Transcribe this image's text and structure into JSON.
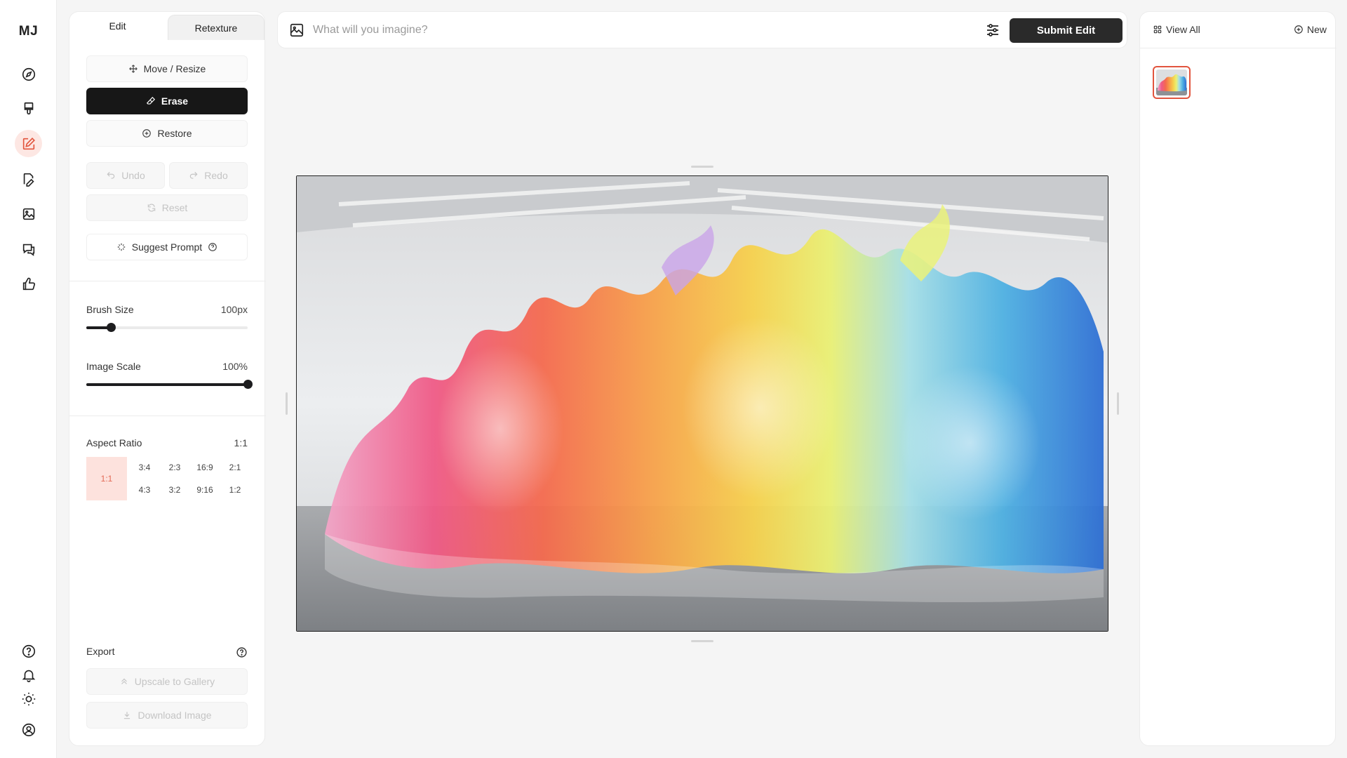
{
  "app": {
    "logo": "MJ"
  },
  "rail": {
    "items": [
      {
        "name": "explore-icon"
      },
      {
        "name": "brush-icon"
      },
      {
        "name": "edit-icon",
        "active": true
      },
      {
        "name": "organize-icon"
      },
      {
        "name": "gallery-icon"
      },
      {
        "name": "chat-icon"
      },
      {
        "name": "like-icon"
      }
    ],
    "bottom": [
      {
        "name": "help-icon"
      },
      {
        "name": "bell-icon"
      },
      {
        "name": "sun-icon"
      },
      {
        "name": "account-icon"
      }
    ]
  },
  "panel": {
    "tabs": {
      "edit": "Edit",
      "retexture": "Retexture"
    },
    "tools": {
      "move_resize": "Move / Resize",
      "erase": "Erase",
      "restore": "Restore"
    },
    "history": {
      "undo": "Undo",
      "redo": "Redo",
      "reset": "Reset"
    },
    "suggest_prompt": "Suggest Prompt",
    "brush_size": {
      "label": "Brush Size",
      "value": "100px",
      "fraction": 0.15
    },
    "image_scale": {
      "label": "Image Scale",
      "value": "100%",
      "fraction": 1.0
    },
    "aspect_ratio": {
      "label": "Aspect Ratio",
      "value": "1:1",
      "selected": "1:1",
      "options_row1": [
        "3:4",
        "2:3",
        "16:9",
        "2:1"
      ],
      "options_row2": [
        "4:3",
        "3:2",
        "9:16",
        "1:2"
      ]
    },
    "export": {
      "label": "Export",
      "upscale": "Upscale to Gallery",
      "download": "Download Image"
    }
  },
  "prompt": {
    "placeholder": "What will you imagine?",
    "value": "",
    "submit": "Submit Edit"
  },
  "right_panel": {
    "view_all": "View All",
    "new": "New"
  },
  "colors": {
    "accent": "#e2553e",
    "accent_soft": "#fde2dd",
    "dark": "#171717"
  }
}
